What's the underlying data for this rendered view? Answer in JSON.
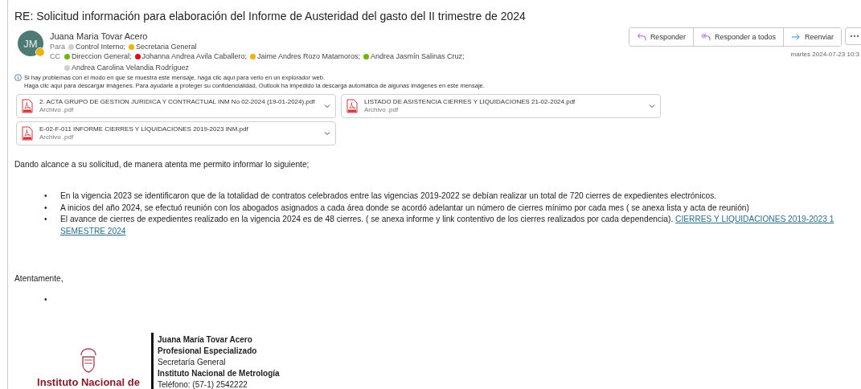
{
  "subject": "RE: Solicitud información para elaboración del Informe de Austeridad del gasto del II trimestre de 2024",
  "sender": {
    "initials": "JM",
    "name": "Juana Maria Tovar Acero",
    "color": "#f1b300"
  },
  "to_label": "Para",
  "to": [
    {
      "name": "Control Interno;",
      "color": "#c9d0d8"
    },
    {
      "name": "Secretaria General",
      "color": "#f1b300"
    }
  ],
  "cc_label": "CC",
  "cc": [
    {
      "name": "Direccion General;",
      "color": "#6bb700"
    },
    {
      "name": "Johanna Andrea Avila Caballero;",
      "color": "#e00b1c"
    },
    {
      "name": "Jaime Andres Rozo Matamoros;",
      "color": "#f1b300"
    },
    {
      "name": "Andrea Jasmín Salinas Cruz;",
      "color": "#6bb700"
    },
    {
      "name": "Andrea Carolina Velandia Rodríguez",
      "color": "#c9d0d8"
    }
  ],
  "actions": [
    {
      "label": "Responder",
      "kind": "reply"
    },
    {
      "label": "Responder a todos",
      "kind": "reply_all"
    },
    {
      "label": "Reenviar",
      "kind": "forward"
    }
  ],
  "date": "martes 2024-07-23 10:3",
  "notices": [
    "Si hay problemas con el modo en que se muestra este mensaje, haga clic aquí para verlo en un explorador web.",
    "Haga clic aquí para descargar imágenes. Para ayudarle a proteger su confidencialidad, Outlook ha impedido la descarga automática de algunas imágenes en este mensaje."
  ],
  "attachments": [
    {
      "name": "2. ACTA GRUPO DE GESTION JURIDICA Y CONTRACTUAL INM  No 02-2024 (19-01-2024).pdf",
      "type": "Archivo .pdf"
    },
    {
      "name": "LISTADO DE ASISTENCIA CIERRES Y LIQUIDACIONES 21-02-2024.pdf",
      "type": "Archivo .pdf"
    },
    {
      "name": "E-02-F-011 INFORME CIERRES Y LIQUIDACIONES 2019-2023 INM.pdf",
      "type": "Archivo .pdf"
    }
  ],
  "intro": "Dando alcance a su solicitud, de manera atenta me permito informar lo siguiente;",
  "bullets": [
    {
      "marker": "•",
      "text": "En la vigencia 2023 se identificaron que de la totalidad de contratos celebrados entre las vigencias 2019-2022 se debían realizar un total de 720 cierres de expedientes electrónicos."
    },
    {
      "marker": "•",
      "text": "A inicios del año 2024, se efectuó reunión con los abogados asignados a cada área donde se acordó adelantar un número de cierres mínimo por cada mes ( se anexa lista y acta de reunión)"
    },
    {
      "marker": "•",
      "text": "El avance de cierres de expedientes realizado en la vigencia 2024 es de 48 cierres. ( se anexa informe y link contentivo de los cierres realizados por cada dependencia).",
      "link_lines": [
        "CIERRES Y LIQUIDACIONES 2019-2023 1",
        "SEMESTRE 2024"
      ]
    }
  ],
  "closing": "Atentamente,",
  "closing_bullet": "•",
  "signature": {
    "logo_text": "Instituto Nacional de",
    "lines": [
      {
        "text": "Juana María Tovar Acero",
        "bold": true
      },
      {
        "text": "Profesional Especializado",
        "bold": true
      },
      {
        "text": "Secretaría General",
        "bold": false
      },
      {
        "text": "Instituto Nacional de Metrología",
        "bold": true
      },
      {
        "text": "Teléfono: (57-1) 2542222",
        "bold": false
      }
    ]
  }
}
